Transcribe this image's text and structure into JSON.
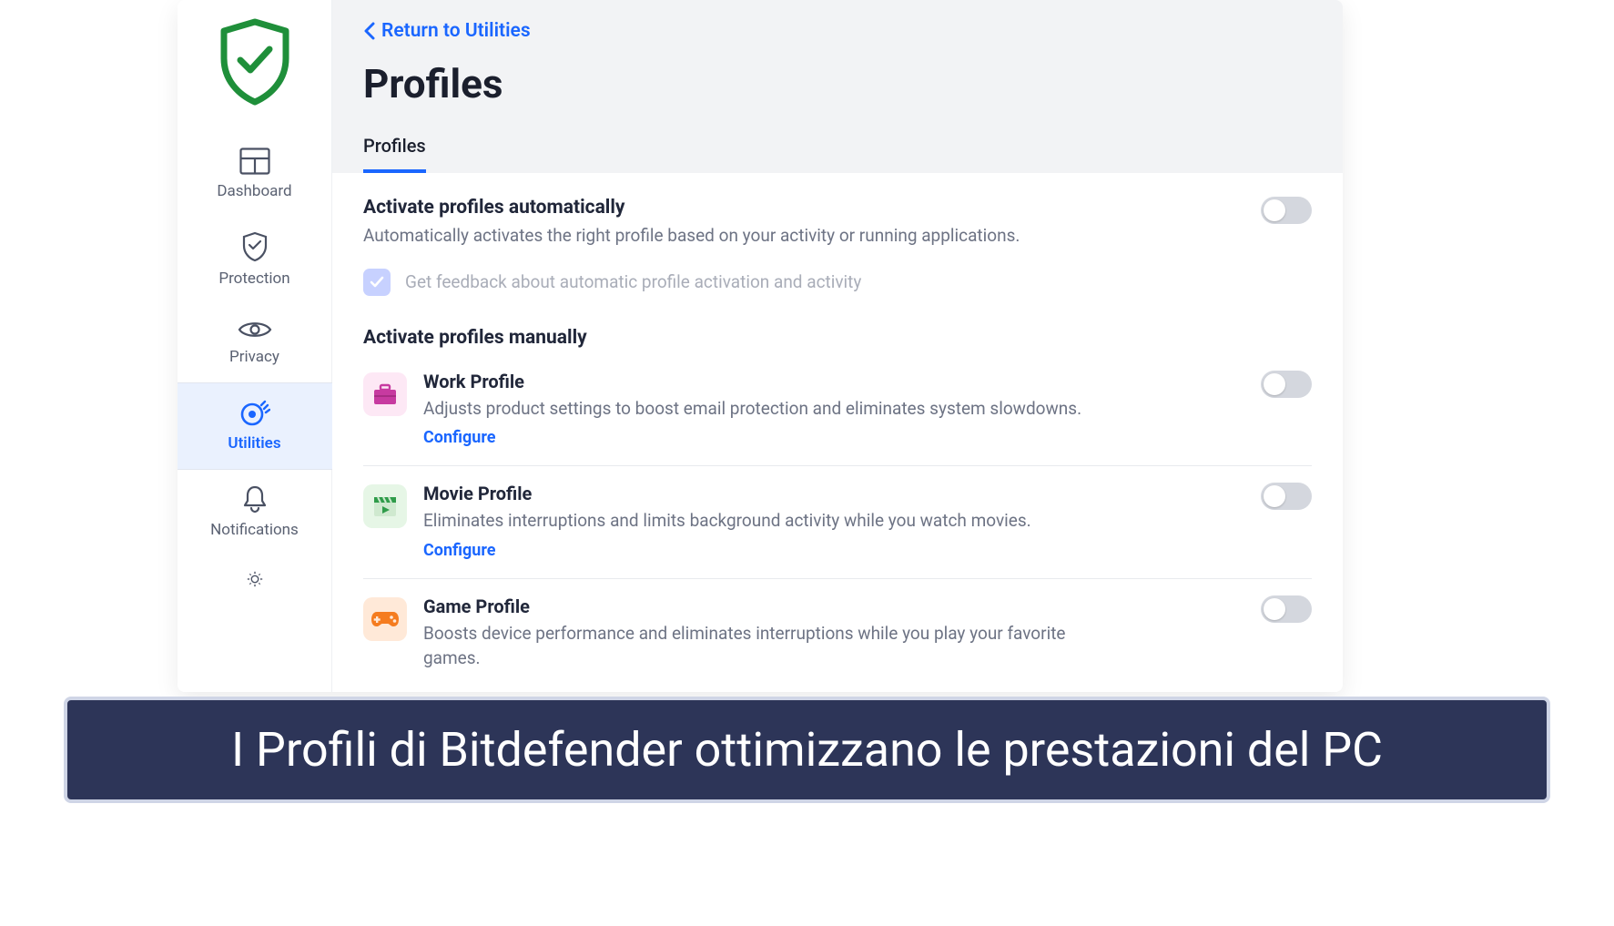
{
  "sidebar": {
    "items": [
      {
        "label": "Dashboard"
      },
      {
        "label": "Protection"
      },
      {
        "label": "Privacy"
      },
      {
        "label": "Utilities"
      },
      {
        "label": "Notifications"
      }
    ]
  },
  "header": {
    "back_label": "Return to Utilities",
    "title": "Profiles",
    "tab_profiles": "Profiles"
  },
  "auto_section": {
    "title": "Activate profiles automatically",
    "subtitle": "Automatically activates the right profile based on your activity or running applications.",
    "feedback_label": "Get feedback about automatic profile activation and activity"
  },
  "manual_section": {
    "title": "Activate profiles manually",
    "configure_label": "Configure",
    "profiles": [
      {
        "name": "Work Profile",
        "desc": "Adjusts product settings to boost email protection and eliminates system slowdowns."
      },
      {
        "name": "Movie Profile",
        "desc": "Eliminates interruptions and limits background activity while you watch movies."
      },
      {
        "name": "Game Profile",
        "desc": "Boosts device performance and eliminates interruptions while you play your favorite games."
      }
    ]
  },
  "caption": "I Profili di Bitdefender ottimizzano le prestazioni del PC"
}
